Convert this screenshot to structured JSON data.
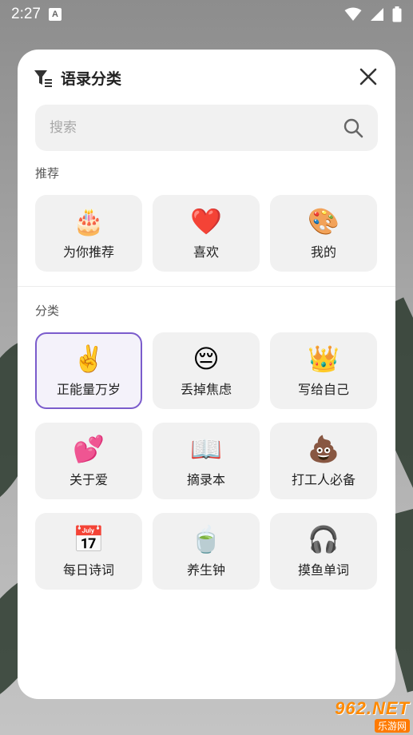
{
  "status_bar": {
    "time": "2:27",
    "notification_letter": "A"
  },
  "dialog": {
    "title": "语录分类",
    "search": {
      "placeholder": "搜索",
      "value": ""
    },
    "sections": [
      {
        "label": "推荐",
        "items": [
          {
            "label": "为你推荐",
            "emoji": "🎂",
            "icon": "birthday-cake-icon"
          },
          {
            "label": "喜欢",
            "emoji": "❤️",
            "icon": "heart-icon"
          },
          {
            "label": "我的",
            "emoji": "🎨",
            "icon": "palette-icon"
          }
        ]
      },
      {
        "label": "分类",
        "items": [
          {
            "label": "正能量万岁",
            "emoji": "✌️",
            "icon": "victory-hand-icon",
            "selected": true
          },
          {
            "label": "丢掉焦虑",
            "emoji": "😔",
            "icon": "pensive-face-icon"
          },
          {
            "label": "写给自己",
            "emoji": "👑",
            "icon": "crown-icon"
          },
          {
            "label": "关于爱",
            "emoji": "💕",
            "icon": "two-hearts-icon"
          },
          {
            "label": "摘录本",
            "emoji": "📖",
            "icon": "open-book-icon"
          },
          {
            "label": "打工人必备",
            "emoji": "💩",
            "icon": "poop-icon"
          },
          {
            "label": "每日诗词",
            "emoji": "📅",
            "icon": "calendar-icon"
          },
          {
            "label": "养生钟",
            "emoji": "🍵",
            "icon": "tea-cup-icon"
          },
          {
            "label": "摸鱼单词",
            "emoji": "🎧",
            "icon": "headphones-icon"
          }
        ]
      }
    ]
  },
  "watermark": {
    "top": "962.NET",
    "bottom": "乐游网"
  },
  "colors": {
    "selected_border": "#7b5ccc",
    "card_bg": "#f1f1f1"
  }
}
